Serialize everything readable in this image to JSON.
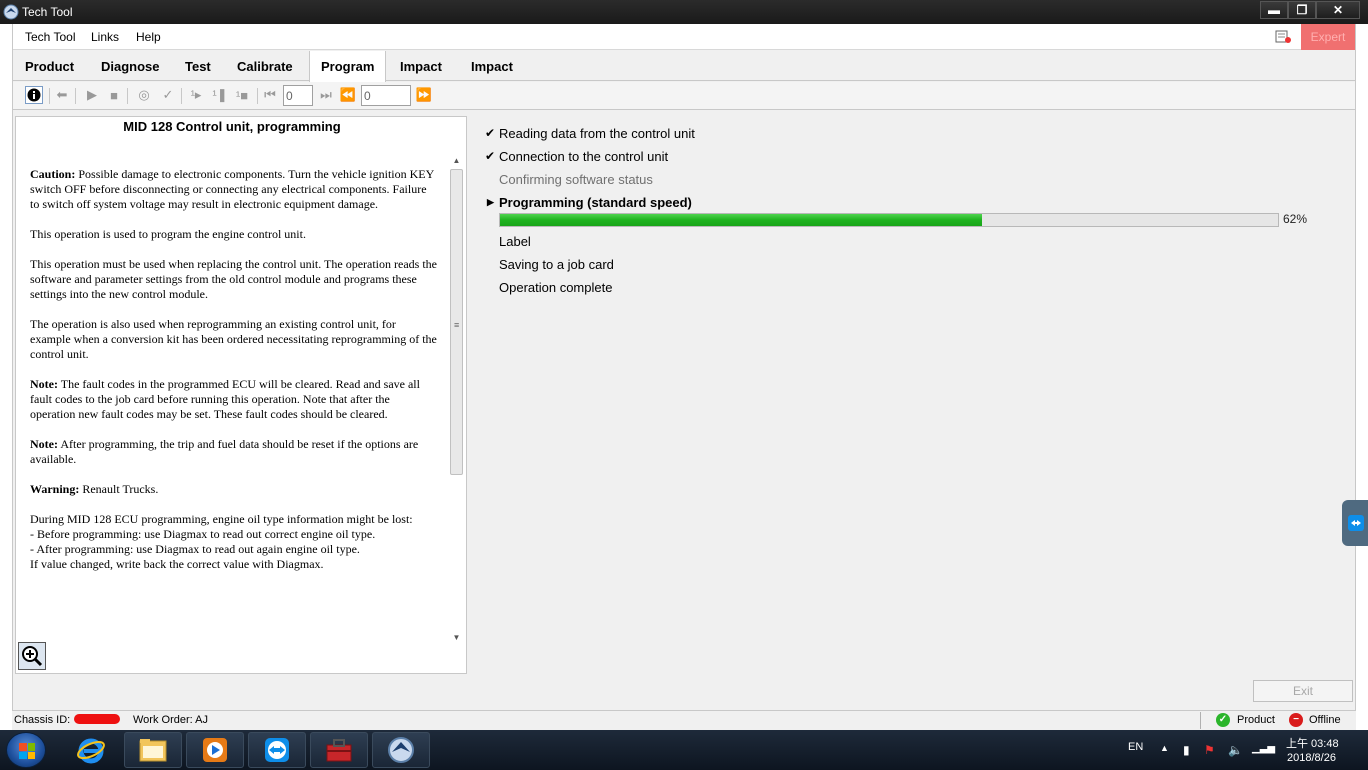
{
  "window": {
    "title": "Tech Tool",
    "minimize_glyph": "▬",
    "restore_glyph": "❐",
    "close_glyph": "✕"
  },
  "menu": {
    "items": [
      "Tech Tool",
      "Links",
      "Help"
    ],
    "expert_label": "Expert"
  },
  "tabs": [
    "Product",
    "Diagnose",
    "Test",
    "Calibrate",
    "Program",
    "Impact",
    "Impact"
  ],
  "active_tab": "Program",
  "toolbar": {
    "step_input_value": "0",
    "skip_input_value": "0"
  },
  "left_panel": {
    "title": "MID 128 Control unit, programming",
    "paragraphs": [
      {
        "lead": "Caution:",
        "text": " Possible damage to electronic components. Turn the vehicle ignition KEY switch OFF before disconnecting or connecting any electrical components. Failure to switch off system voltage may result in electronic equipment damage."
      },
      {
        "lead": "",
        "text": "This operation is used to program the engine control unit."
      },
      {
        "lead": "",
        "text": "This operation must be used when replacing the control unit. The operation reads the software and parameter settings from the old control module and programs these settings into the new control module."
      },
      {
        "lead": "",
        "text": "The operation is also used when reprogramming an existing control unit, for example when a conversion kit has been ordered necessitating reprogramming of the control unit."
      },
      {
        "lead": "Note:",
        "text": " The fault codes in the programmed ECU will be cleared. Read and save all fault codes to the job card before running this operation. Note that after the operation new fault codes may be set. These fault codes should be cleared."
      },
      {
        "lead": "Note:",
        "text": " After programming, the trip and fuel data should be reset if the options are available."
      },
      {
        "lead": "Warning:",
        "text": " Renault Trucks."
      }
    ],
    "final_lines": [
      "During MID 128 ECU programming, engine oil type information might be lost:",
      "- Before programming: use Diagmax to read out correct engine oil type.",
      "- After programming: use Diagmax to read out again engine oil type.",
      "If value changed, write back the correct value with Diagmax."
    ]
  },
  "steps": [
    {
      "label": "Reading data from the control unit",
      "state": "done",
      "mark": "✔"
    },
    {
      "label": "Connection to the control unit",
      "state": "done",
      "mark": "✔"
    },
    {
      "label": "Confirming software status",
      "state": "dim",
      "mark": ""
    },
    {
      "label": "Programming  (standard speed)",
      "state": "current",
      "mark": "▶"
    },
    {
      "label": "Label",
      "state": "pending",
      "mark": ""
    },
    {
      "label": "Saving to a job card",
      "state": "pending",
      "mark": ""
    },
    {
      "label": "Operation complete",
      "state": "pending",
      "mark": ""
    }
  ],
  "progress": {
    "fraction": 0.62,
    "label": "62%"
  },
  "exit_label": "Exit",
  "status": {
    "chassis_label": "Chassis ID:",
    "work_order": "Work Order: AJ",
    "product": "Product",
    "offline": "Offline"
  },
  "taskbar": {
    "language": "EN",
    "time": "上午 03:48",
    "date": "2018/8/26"
  },
  "colors": {
    "progress_green": "#1fb31f",
    "expert_bg": "#f07070",
    "product_ok": "#2bb52b",
    "offline_red": "#d91c1c"
  }
}
